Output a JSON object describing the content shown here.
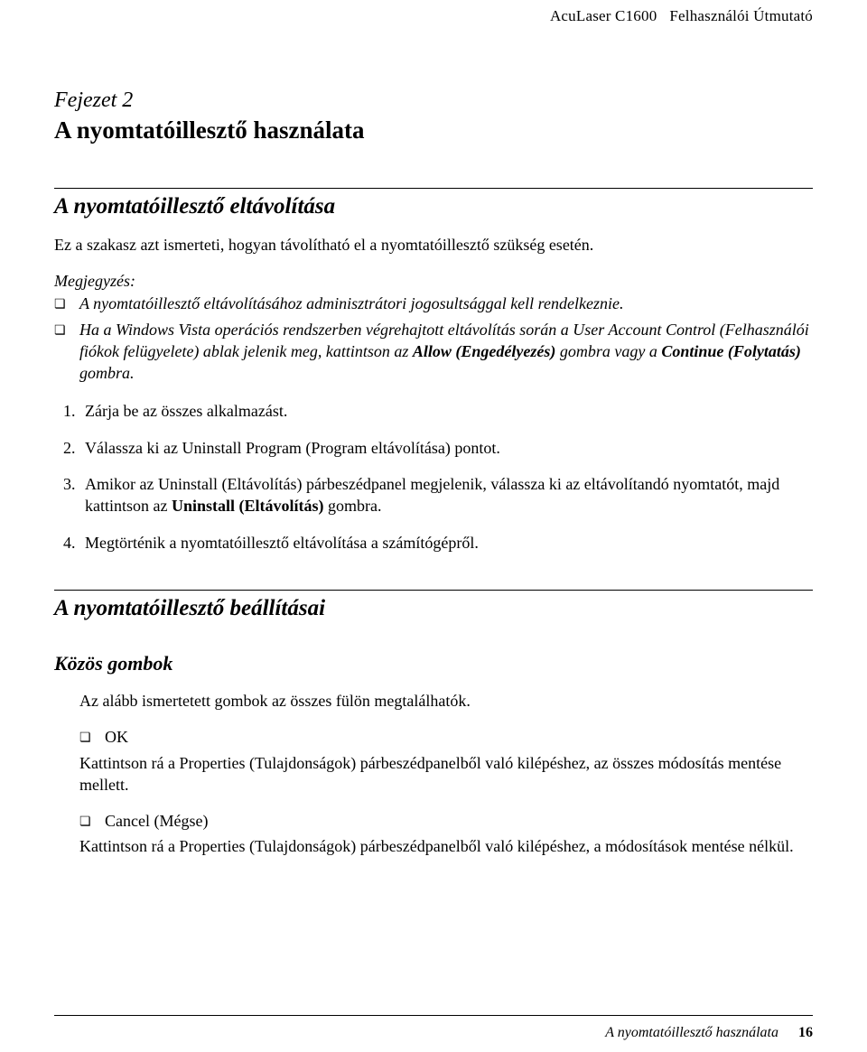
{
  "header": {
    "product": "AcuLaser C1600",
    "doc": "Felhasználói Útmutató"
  },
  "chapter": {
    "label": "Fejezet 2",
    "title": "A nyomtatóillesztő használata"
  },
  "section1": {
    "title": "A nyomtatóillesztő eltávolítása",
    "intro": "Ez a szakasz azt ismerteti, hogyan távolítható el a nyomtatóillesztő szükség esetén.",
    "notesLabel": "Megjegyzés:",
    "note1": "A nyomtatóillesztő eltávolításához adminisztrátori jogosultsággal kell rendelkeznie.",
    "note2_pre": "Ha a Windows Vista operációs rendszerben végrehajtott eltávolítás során a User Account Control (Felhasználói fiókok felügyelete) ablak jelenik meg, kattintson az ",
    "note2_b1": "Allow (Engedélyezés)",
    "note2_mid": " gombra vagy a ",
    "note2_b2": "Continue (Folytatás)",
    "note2_post": " gombra.",
    "step1": "Zárja be az összes alkalmazást.",
    "step2": "Válassza ki az Uninstall Program (Program eltávolítása) pontot.",
    "step3_pre": "Amikor az Uninstall (Eltávolítás) párbeszédpanel megjelenik, válassza ki az eltávolítandó nyomtatót, majd kattintson az ",
    "step3_b": "Uninstall (Eltávolítás)",
    "step3_post": " gombra.",
    "step4": "Megtörténik a nyomtatóillesztő eltávolítása a számítógépről."
  },
  "section2": {
    "title": "A nyomtatóillesztő beállításai",
    "subTitle": "Közös gombok",
    "intro": "Az alább ismertetett gombok az összes fülön megtalálhatók.",
    "ok": {
      "label": "OK",
      "desc": "Kattintson rá a Properties (Tulajdonságok) párbeszédpanelből való kilépéshez, az összes módosítás mentése mellett."
    },
    "cancel": {
      "label": "Cancel (Mégse)",
      "desc": "Kattintson rá a Properties (Tulajdonságok) párbeszédpanelből való kilépéshez, a módosítások mentése nélkül."
    }
  },
  "footer": {
    "title": "A nyomtatóillesztő használata",
    "page": "16"
  }
}
